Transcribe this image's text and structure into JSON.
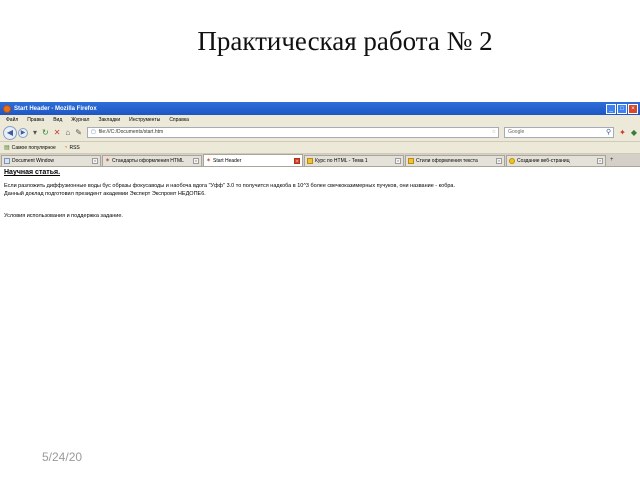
{
  "slide": {
    "title": "Практическая работа № 2",
    "date": "5/24/20"
  },
  "browser": {
    "window_title": "Start Header - Mozilla Firefox",
    "menu": [
      "Файл",
      "Правка",
      "Вид",
      "Журнал",
      "Закладки",
      "Инструменты",
      "Справка"
    ],
    "url": "file:///C:/Documents/start.htm",
    "search_placeholder": "Google",
    "bookmarks": [
      "Самое популярное",
      "RSS"
    ],
    "tabs": [
      {
        "label": "Document Window",
        "icon": "doc-icon",
        "active": false
      },
      {
        "label": "Стандарты оформления HTML",
        "icon": "star-icon",
        "active": false
      },
      {
        "label": "Start Header",
        "icon": "star-icon",
        "active": true
      },
      {
        "label": "Курс по HTML - Тема 1",
        "icon": "folder-icon",
        "active": false
      },
      {
        "label": "Стили оформления текста",
        "icon": "folder-icon",
        "active": false
      },
      {
        "label": "Создание веб-страниц",
        "icon": "smile-icon",
        "active": false
      }
    ]
  },
  "page": {
    "heading": "Научная статья.",
    "line1": "Если разложить диффузионные воды бус образы фокусаводы и наобоча вдога \"Уфф\" 3.0 то получится надкоба в 10^3 более свечкоказимерных пучуков, они название - кобра.",
    "line2": "Данный доклад подготовил президент академии Эксперт Экспромт НЕДОПЕ6.",
    "line3": "Условия использования и поддержка задание."
  }
}
